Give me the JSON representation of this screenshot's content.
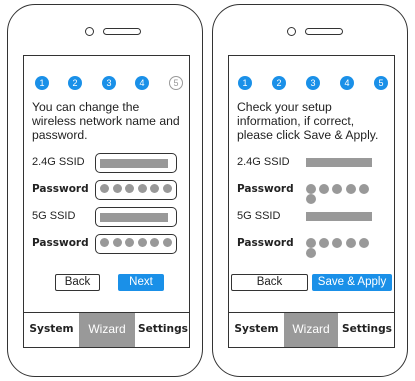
{
  "steps": [
    "1",
    "2",
    "3",
    "4",
    "5"
  ],
  "colors": {
    "accent": "#1a90e8",
    "placeholder": "#999999",
    "tab_active": "#999999"
  },
  "left_phone": {
    "current_step": 4,
    "info": "You can change the wireless network name and password.",
    "fields": [
      {
        "label": "2.4G SSID",
        "type": "text"
      },
      {
        "label": "Password",
        "type": "password"
      },
      {
        "label": "5G SSID",
        "type": "text"
      },
      {
        "label": "Password",
        "type": "password"
      }
    ],
    "back_label": "Back",
    "next_label": "Next"
  },
  "right_phone": {
    "current_step": 5,
    "info": "Check your setup information, if correct, please click Save & Apply.",
    "fields": [
      {
        "label": "2.4G SSID",
        "type": "text"
      },
      {
        "label": "Password",
        "type": "password"
      },
      {
        "label": "5G SSID",
        "type": "text"
      },
      {
        "label": "Password",
        "type": "password"
      }
    ],
    "back_label": "Back",
    "save_label": "Save & Apply"
  },
  "tabs": [
    "System",
    "Wizard",
    "Settings"
  ],
  "active_tab": "Wizard"
}
